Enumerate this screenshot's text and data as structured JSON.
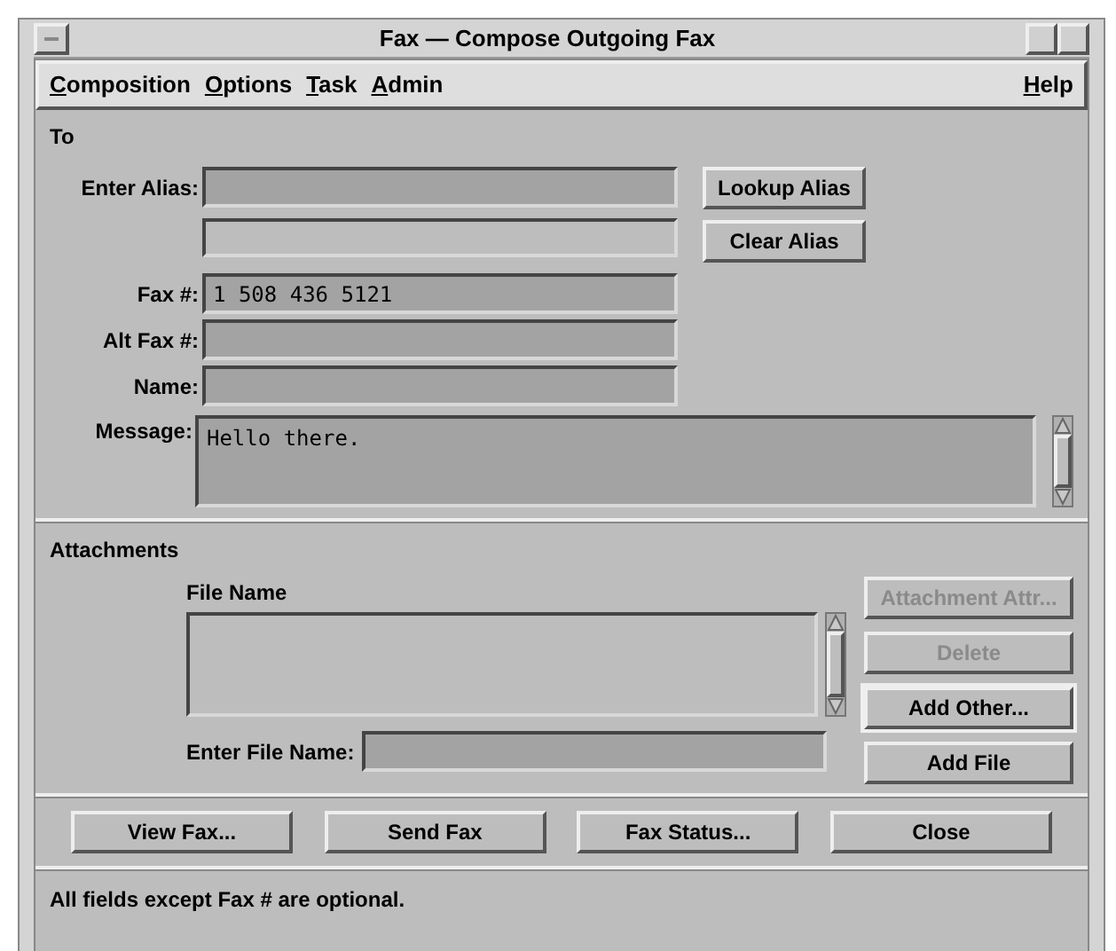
{
  "window": {
    "title": "Fax — Compose Outgoing Fax"
  },
  "menu": [
    {
      "label": "Composition"
    },
    {
      "label": "Options"
    },
    {
      "label": "Task"
    },
    {
      "label": "Admin"
    }
  ],
  "help_menu": {
    "label": "Help"
  },
  "to": {
    "heading": "To",
    "alias": {
      "label": "Enter Alias:"
    },
    "buttons": [
      {
        "label": "Lookup Alias",
        "disabled": false
      },
      {
        "label": "Clear Alias",
        "disabled": false
      }
    ],
    "fields": [
      {
        "label": "Fax #:",
        "value": "1 508 436 5121"
      },
      {
        "label": "Alt Fax #:"
      },
      {
        "label": "Name:"
      }
    ],
    "message": {
      "label": "Message:",
      "value": "Hello there."
    }
  },
  "attachments": {
    "heading": "Attachments",
    "list_heading": "File Name",
    "file_field": {
      "label": "Enter File Name:"
    },
    "buttons": [
      {
        "label": "Attachment Attr...",
        "disabled": true,
        "default": false
      },
      {
        "label": "Delete",
        "disabled": true,
        "default": false
      },
      {
        "label": "Add Other...",
        "disabled": false,
        "default": true
      },
      {
        "label": "Add File",
        "disabled": false,
        "default": false
      }
    ]
  },
  "actions": [
    {
      "label": "View Fax..."
    },
    {
      "label": "Send Fax"
    },
    {
      "label": "Fax Status..."
    },
    {
      "label": "Close"
    }
  ],
  "status_bar": "All fields except Fax # are optional."
}
